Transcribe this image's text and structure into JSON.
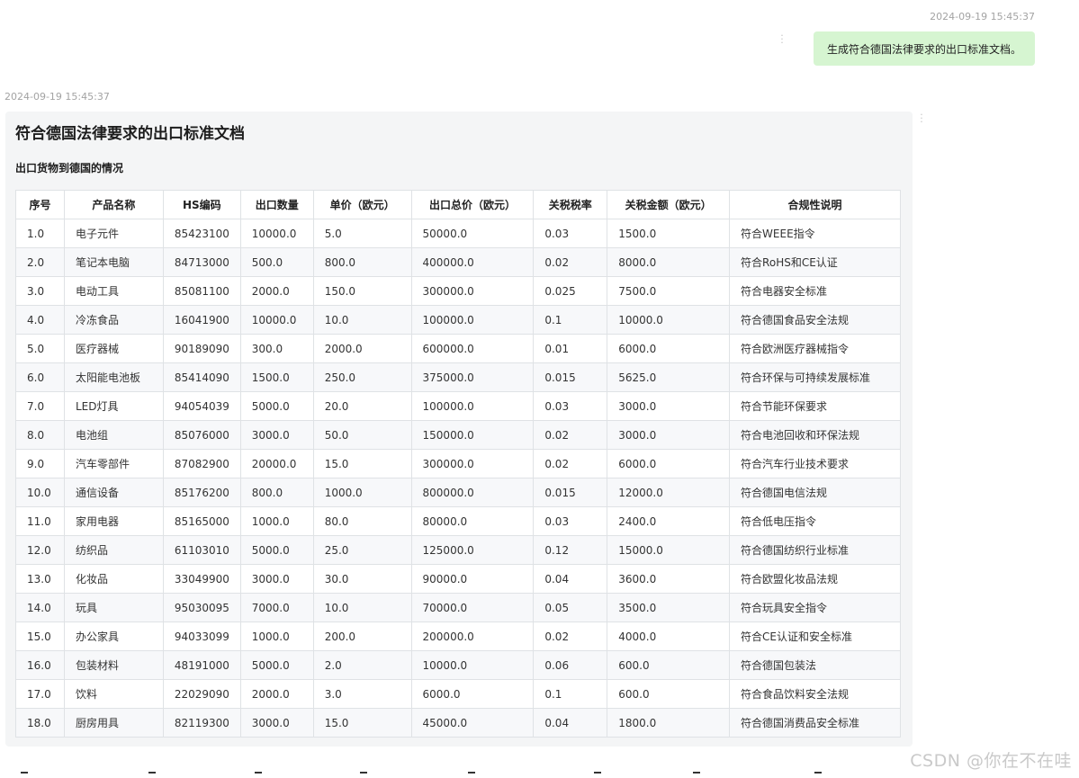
{
  "user_message": {
    "timestamp": "2024-09-19 15:45:37",
    "text": "生成符合德国法律要求的出口标准文档。"
  },
  "bot_message": {
    "timestamp": "2024-09-19 15:45:37",
    "title": "符合德国法律要求的出口标准文档",
    "section_title": "出口货物到德国的情况",
    "table": {
      "headers": [
        "序号",
        "产品名称",
        "HS编码",
        "出口数量",
        "单价（欧元）",
        "出口总价（欧元）",
        "关税税率",
        "关税金额（欧元）",
        "合规性说明"
      ],
      "rows": [
        [
          "1.0",
          "电子元件",
          "85423100",
          "10000.0",
          "5.0",
          "50000.0",
          "0.03",
          "1500.0",
          "符合WEEE指令"
        ],
        [
          "2.0",
          "笔记本电脑",
          "84713000",
          "500.0",
          "800.0",
          "400000.0",
          "0.02",
          "8000.0",
          "符合RoHS和CE认证"
        ],
        [
          "3.0",
          "电动工具",
          "85081100",
          "2000.0",
          "150.0",
          "300000.0",
          "0.025",
          "7500.0",
          "符合电器安全标准"
        ],
        [
          "4.0",
          "冷冻食品",
          "16041900",
          "10000.0",
          "10.0",
          "100000.0",
          "0.1",
          "10000.0",
          "符合德国食品安全法规"
        ],
        [
          "5.0",
          "医疗器械",
          "90189090",
          "300.0",
          "2000.0",
          "600000.0",
          "0.01",
          "6000.0",
          "符合欧洲医疗器械指令"
        ],
        [
          "6.0",
          "太阳能电池板",
          "85414090",
          "1500.0",
          "250.0",
          "375000.0",
          "0.015",
          "5625.0",
          "符合环保与可持续发展标准"
        ],
        [
          "7.0",
          "LED灯具",
          "94054039",
          "5000.0",
          "20.0",
          "100000.0",
          "0.03",
          "3000.0",
          "符合节能环保要求"
        ],
        [
          "8.0",
          "电池组",
          "85076000",
          "3000.0",
          "50.0",
          "150000.0",
          "0.02",
          "3000.0",
          "符合电池回收和环保法规"
        ],
        [
          "9.0",
          "汽车零部件",
          "87082900",
          "20000.0",
          "15.0",
          "300000.0",
          "0.02",
          "6000.0",
          "符合汽车行业技术要求"
        ],
        [
          "10.0",
          "通信设备",
          "85176200",
          "800.0",
          "1000.0",
          "800000.0",
          "0.015",
          "12000.0",
          "符合德国电信法规"
        ],
        [
          "11.0",
          "家用电器",
          "85165000",
          "1000.0",
          "80.0",
          "80000.0",
          "0.03",
          "2400.0",
          "符合低电压指令"
        ],
        [
          "12.0",
          "纺织品",
          "61103010",
          "5000.0",
          "25.0",
          "125000.0",
          "0.12",
          "15000.0",
          "符合德国纺织行业标准"
        ],
        [
          "13.0",
          "化妆品",
          "33049900",
          "3000.0",
          "30.0",
          "90000.0",
          "0.04",
          "3600.0",
          "符合欧盟化妆品法规"
        ],
        [
          "14.0",
          "玩具",
          "95030095",
          "7000.0",
          "10.0",
          "70000.0",
          "0.05",
          "3500.0",
          "符合玩具安全指令"
        ],
        [
          "15.0",
          "办公家具",
          "94033099",
          "1000.0",
          "200.0",
          "200000.0",
          "0.02",
          "4000.0",
          "符合CE认证和安全标准"
        ],
        [
          "16.0",
          "包装材料",
          "48191000",
          "5000.0",
          "2.0",
          "10000.0",
          "0.06",
          "600.0",
          "符合德国包装法"
        ],
        [
          "17.0",
          "饮料",
          "22029090",
          "2000.0",
          "3.0",
          "6000.0",
          "0.1",
          "600.0",
          "符合食品饮料安全法规"
        ],
        [
          "18.0",
          "厨房用具",
          "82119300",
          "3000.0",
          "15.0",
          "45000.0",
          "0.04",
          "1800.0",
          "符合德国消费品安全标准"
        ]
      ]
    }
  },
  "watermark": "CSDN @你在不在哇"
}
